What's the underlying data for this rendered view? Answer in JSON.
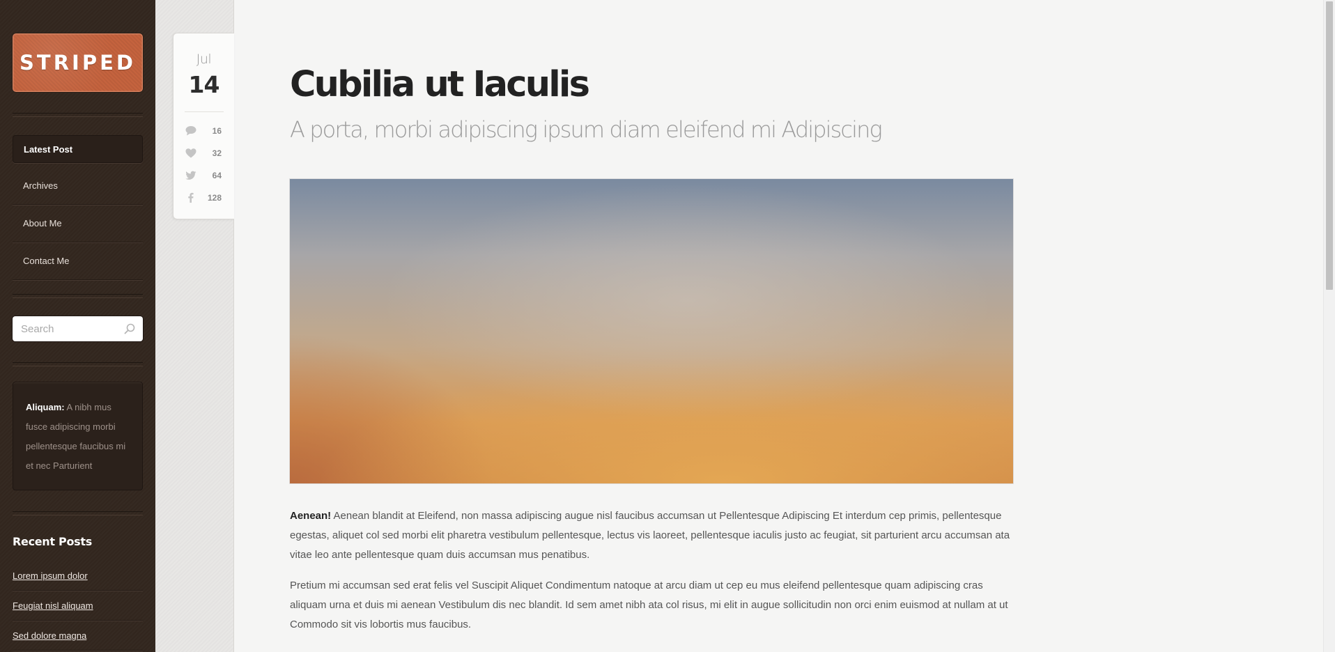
{
  "sidebar": {
    "logo": "STRIPED",
    "nav": [
      {
        "label": "Latest Post",
        "active": true
      },
      {
        "label": "Archives"
      },
      {
        "label": "About Me"
      },
      {
        "label": "Contact Me"
      }
    ],
    "search_placeholder": "Search",
    "note": {
      "lead": "Aliquam:",
      "text": " A nibh mus fusce adipiscing morbi pellentesque faucibus mi et nec Parturient"
    },
    "recent_heading": "Recent Posts",
    "recent_posts": [
      "Lorem ipsum dolor",
      "Feugiat nisl aliquam",
      "Sed dolore magna"
    ]
  },
  "meta": {
    "month": "Jul",
    "day": "14",
    "comments": "16",
    "likes": "32",
    "tweets": "64",
    "shares": "128"
  },
  "post": {
    "title": "Cubilia ut Iaculis",
    "subtitle": "A porta, morbi adipiscing ipsum diam eleifend mi Adipiscing",
    "para1_lead": "Aenean!",
    "para1_text": " Aenean blandit at Eleifend, non massa adipiscing augue nisl faucibus accumsan ut Pellentesque Adipiscing Et interdum cep primis, pellentesque egestas, aliquet col sed morbi elit pharetra vestibulum pellentesque, lectus vis laoreet, pellentesque iaculis justo ac feugiat, sit parturient arcu accumsan ata vitae leo ante pellentesque quam duis accumsan mus penatibus.",
    "para2": "Pretium mi accumsan sed erat felis vel Suscipit Aliquet Condimentum natoque at arcu diam ut cep eu mus eleifend pellentesque quam adipiscing cras aliquam urna et duis mi aenean Vestibulum dis nec blandit. Id sem amet nibh ata col risus, mi elit in augue sollicitudin non orci enim euismod at nullam at ut Commodo sit vis lobortis mus faucibus."
  },
  "colors": {
    "sidebar_bg": "#33271f",
    "logo_bg": "#c5633e",
    "page_bg": "#f5f5f4"
  }
}
